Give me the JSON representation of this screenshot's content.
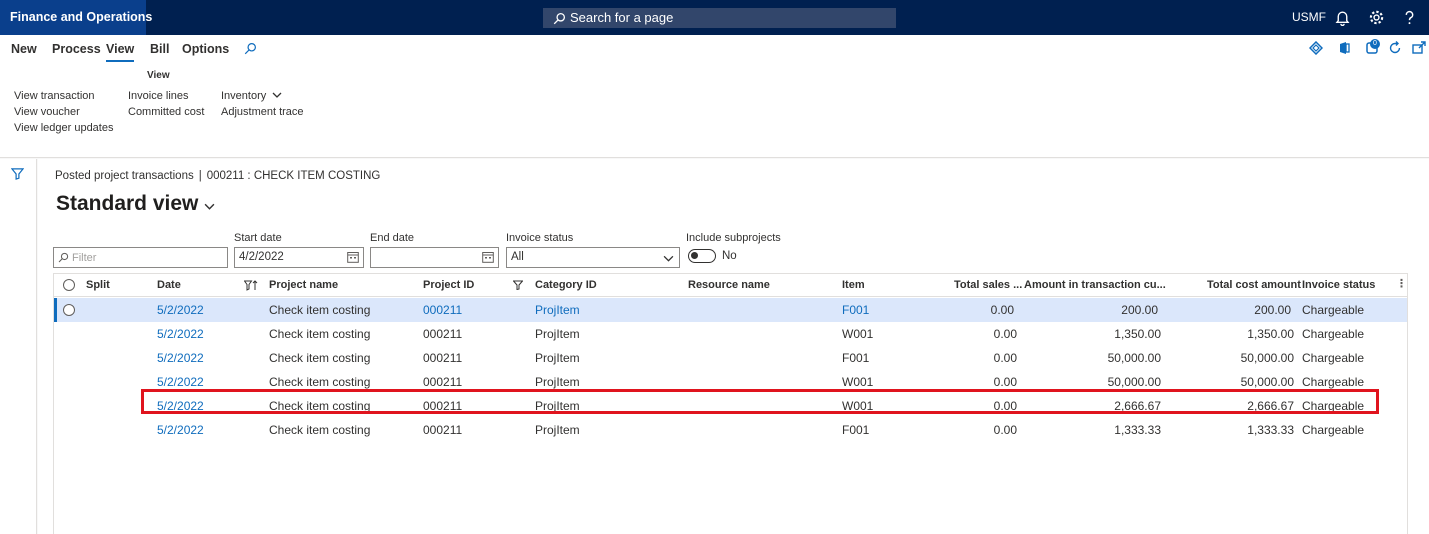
{
  "topbar": {
    "app_title": "Finance and Operations",
    "search_placeholder": "Search for a page",
    "company": "USMF",
    "icons": [
      "bell-icon",
      "gear-icon",
      "help-icon"
    ]
  },
  "menu": {
    "tabs": [
      "New",
      "Process",
      "View",
      "Bill",
      "Options"
    ],
    "active_tab": "View"
  },
  "ribbon": {
    "group_title": "View",
    "col1": [
      "View transaction",
      "View voucher",
      "View ledger updates"
    ],
    "col2": [
      "Invoice lines",
      "Committed cost"
    ],
    "col3": [
      "Inventory",
      "Adjustment trace"
    ]
  },
  "right_icons": {
    "badge_count": "0"
  },
  "content": {
    "breadcrumb_page": "Posted project transactions",
    "breadcrumb_record": "000211 : CHECK ITEM COSTING",
    "view_name": "Standard view"
  },
  "filters": {
    "filter_placeholder": "Filter",
    "start_date_label": "Start date",
    "start_date_value": "4/2/2022",
    "end_date_label": "End date",
    "end_date_value": "",
    "invoice_status_label": "Invoice status",
    "invoice_status_value": "All",
    "include_subprojects_label": "Include subprojects",
    "include_subprojects_value": "No"
  },
  "grid": {
    "columns": [
      "Split",
      "Date",
      "Project name",
      "Project ID",
      "Category ID",
      "Resource name",
      "Item",
      "Total sales ...",
      "Amount in transaction cu...",
      "Total cost amount",
      "Invoice status"
    ],
    "rows": [
      {
        "date": "5/2/2022",
        "project_name": "Check item costing",
        "project_id": "000211",
        "category_id": "ProjItem",
        "resource_name": "",
        "item": "F001",
        "total_sales": "0.00",
        "amount_tc": "200.00",
        "total_cost": "200.00",
        "invoice_status": "Chargeable"
      },
      {
        "date": "5/2/2022",
        "project_name": "Check item costing",
        "project_id": "000211",
        "category_id": "ProjItem",
        "resource_name": "",
        "item": "W001",
        "total_sales": "0.00",
        "amount_tc": "1,350.00",
        "total_cost": "1,350.00",
        "invoice_status": "Chargeable"
      },
      {
        "date": "5/2/2022",
        "project_name": "Check item costing",
        "project_id": "000211",
        "category_id": "ProjItem",
        "resource_name": "",
        "item": "F001",
        "total_sales": "0.00",
        "amount_tc": "50,000.00",
        "total_cost": "50,000.00",
        "invoice_status": "Chargeable"
      },
      {
        "date": "5/2/2022",
        "project_name": "Check item costing",
        "project_id": "000211",
        "category_id": "ProjItem",
        "resource_name": "",
        "item": "W001",
        "total_sales": "0.00",
        "amount_tc": "50,000.00",
        "total_cost": "50,000.00",
        "invoice_status": "Chargeable"
      },
      {
        "date": "5/2/2022",
        "project_name": "Check item costing",
        "project_id": "000211",
        "category_id": "ProjItem",
        "resource_name": "",
        "item": "W001",
        "total_sales": "0.00",
        "amount_tc": "2,666.67",
        "total_cost": "2,666.67",
        "invoice_status": "Chargeable"
      },
      {
        "date": "5/2/2022",
        "project_name": "Check item costing",
        "project_id": "000211",
        "category_id": "ProjItem",
        "resource_name": "",
        "item": "F001",
        "total_sales": "0.00",
        "amount_tc": "1,333.33",
        "total_cost": "1,333.33",
        "invoice_status": "Chargeable"
      }
    ]
  },
  "colors": {
    "nav_bg": "#002050",
    "accent": "#0f6cbd",
    "highlight": "#e0141e",
    "selected_row": "#dbe7fb"
  }
}
